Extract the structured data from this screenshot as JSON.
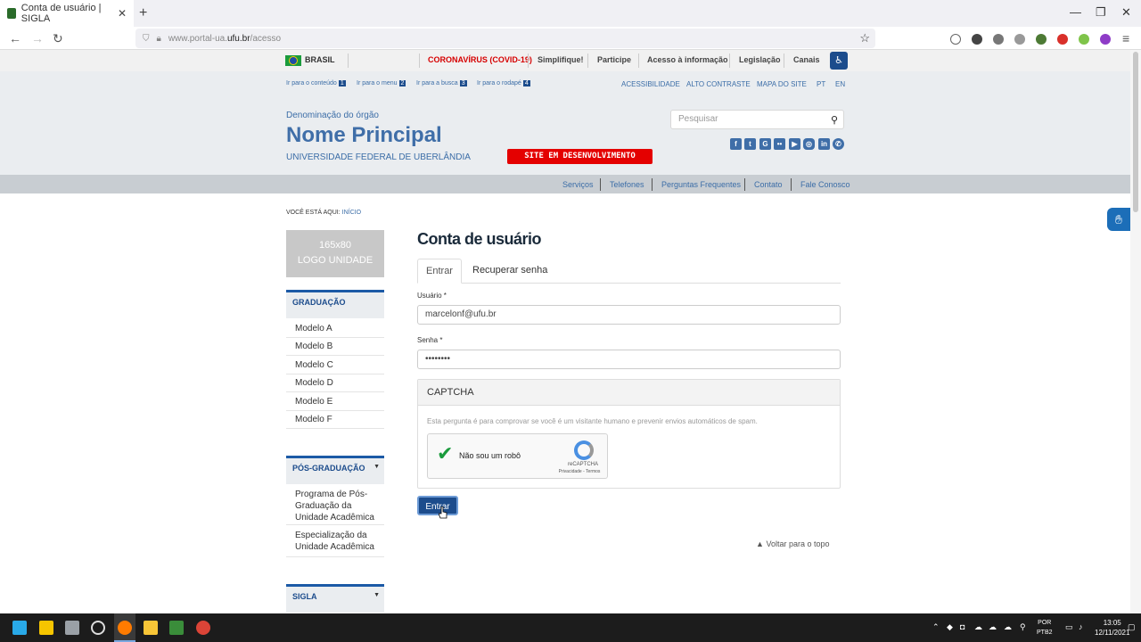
{
  "browser": {
    "tab_title": "Conta de usuário | SIGLA",
    "url_prefix": "www.portal-ua.",
    "url_host": "ufu.br",
    "url_path": "/acesso"
  },
  "gov_bar": {
    "country": "BRASIL",
    "links": [
      "CORONAVÍRUS (COVID-19)",
      "Simplifique!",
      "Participe",
      "Acesso à informação",
      "Legislação",
      "Canais"
    ]
  },
  "skip_links": [
    {
      "label": "Ir para o conteúdo",
      "num": "1"
    },
    {
      "label": "Ir para o menu",
      "num": "2"
    },
    {
      "label": "Ir para a busca",
      "num": "3"
    },
    {
      "label": "Ir para o rodapé",
      "num": "4"
    }
  ],
  "top_links": [
    "ACESSIBILIDADE",
    "ALTO CONTRASTE",
    "MAPA DO SITE",
    "PT",
    "EN"
  ],
  "header": {
    "org_label": "Denominação do órgão",
    "main_name": "Nome Principal",
    "university": "UNIVERSIDADE FEDERAL DE UBERLÂNDIA",
    "dev_badge": "SITE EM DESENVOLVIMENTO",
    "search_placeholder": "Pesquisar",
    "social_icons": [
      "facebook-icon",
      "twitter-icon",
      "google-plus-icon",
      "flickr-icon",
      "youtube-icon",
      "instagram-icon",
      "linkedin-icon",
      "whatsapp-icon"
    ]
  },
  "services": [
    "Serviços",
    "Telefones",
    "Perguntas Frequentes",
    "Contato",
    "Fale Conosco"
  ],
  "breadcrumb": {
    "prefix": "VOCÊ ESTÁ AQUI:",
    "home": "INÍCIO"
  },
  "sidebar": {
    "logo_size": "165x80",
    "logo_text": "LOGO UNIDADE",
    "graduacao": {
      "title": "GRADUAÇÃO",
      "items": [
        "Modelo A",
        "Modelo B",
        "Modelo C",
        "Modelo D",
        "Modelo E",
        "Modelo F"
      ]
    },
    "pos": {
      "title": "PÓS-GRADUAÇÃO",
      "items": [
        "Programa de Pós-Graduação da Unidade Acadêmica",
        "Especialização da Unidade Acadêmica"
      ]
    },
    "sigla": {
      "title": "SIGLA"
    }
  },
  "content": {
    "title": "Conta de usuário",
    "tabs": [
      "Entrar",
      "Recuperar senha"
    ],
    "user_label": "Usuário *",
    "user_value": "marcelonf@ufu.br",
    "pass_label": "Senha *",
    "pass_value": "••••••••",
    "captcha_title": "CAPTCHA",
    "captcha_desc": "Esta pergunta é para comprovar se você é um visitante humano e prevenir envios automáticos de spam.",
    "recaptcha_label": "Não sou um robô",
    "recaptcha_brand": "reCAPTCHA",
    "recaptcha_terms": "Privacidade - Termos",
    "submit": "Entrar",
    "back_top": "Voltar para o topo"
  },
  "taskbar": {
    "lang_1": "POR",
    "lang_2": "PTB2",
    "time": "13:05",
    "date": "12/11/2021"
  }
}
